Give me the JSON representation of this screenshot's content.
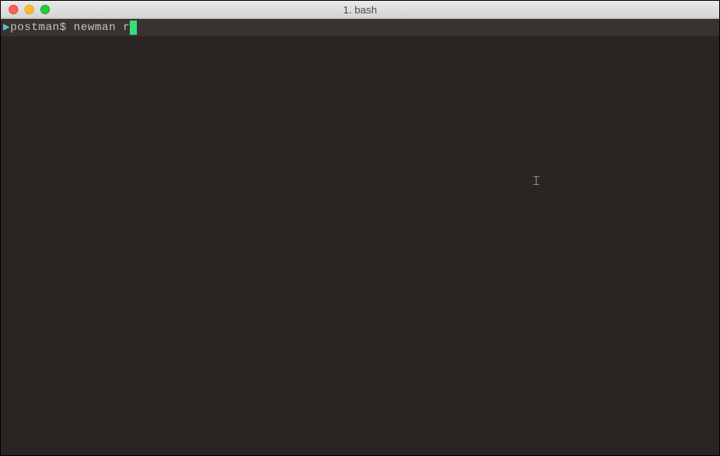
{
  "window": {
    "title": "1. bash"
  },
  "terminal": {
    "prompt_marker": "▶",
    "prompt": "postman$",
    "input": " newman r"
  },
  "colors": {
    "bg": "#2a2422",
    "linebg": "#3a3230",
    "text": "#c9c1bd",
    "cursor": "#33e07a",
    "arrow": "#5fc0d8"
  }
}
